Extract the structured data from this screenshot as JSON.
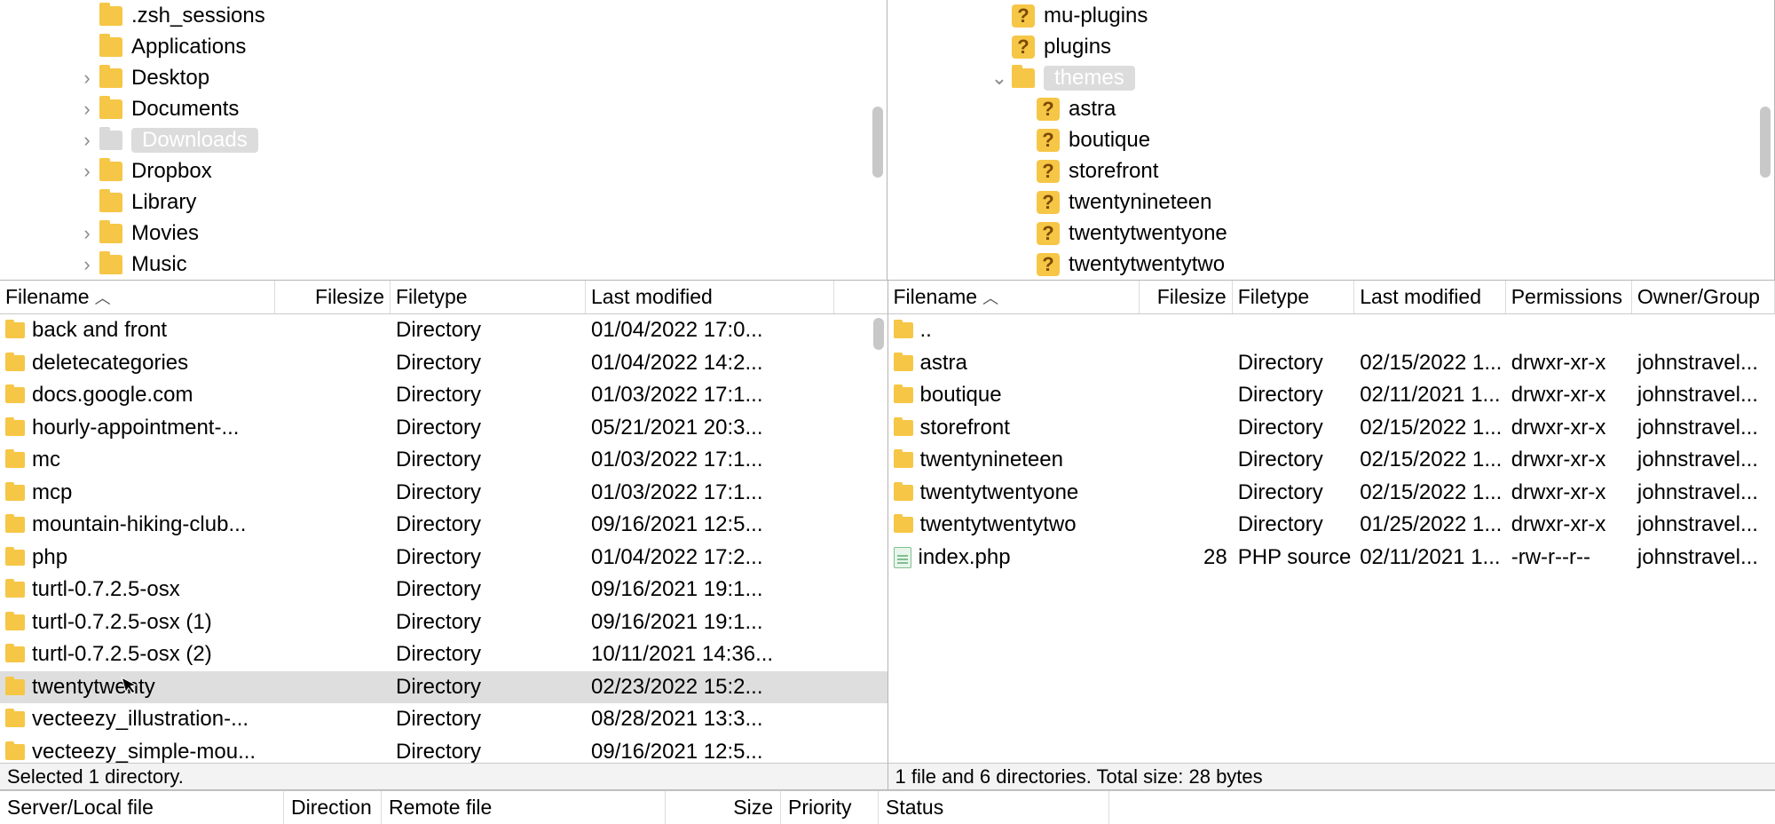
{
  "left_tree": [
    {
      "indent": 3,
      "chev": "",
      "icon": "folder",
      "label": ".zsh_sessions"
    },
    {
      "indent": 3,
      "chev": "",
      "icon": "folder",
      "label": "Applications"
    },
    {
      "indent": 3,
      "chev": ">",
      "icon": "folder",
      "label": "Desktop"
    },
    {
      "indent": 3,
      "chev": ">",
      "icon": "folder",
      "label": "Documents"
    },
    {
      "indent": 3,
      "chev": ">",
      "icon": "folder-sel",
      "label": "Downloads",
      "selected": true
    },
    {
      "indent": 3,
      "chev": ">",
      "icon": "folder",
      "label": "Dropbox"
    },
    {
      "indent": 3,
      "chev": "",
      "icon": "folder",
      "label": "Library"
    },
    {
      "indent": 3,
      "chev": ">",
      "icon": "folder",
      "label": "Movies"
    },
    {
      "indent": 3,
      "chev": ">",
      "icon": "folder",
      "label": "Music"
    }
  ],
  "right_tree": [
    {
      "indent": 4,
      "chev": "",
      "icon": "q",
      "label": "mu-plugins"
    },
    {
      "indent": 4,
      "chev": "",
      "icon": "q",
      "label": "plugins"
    },
    {
      "indent": 4,
      "chev": "v",
      "icon": "folder",
      "label": "themes",
      "selected": true
    },
    {
      "indent": 5,
      "chev": "",
      "icon": "q",
      "label": "astra"
    },
    {
      "indent": 5,
      "chev": "",
      "icon": "q",
      "label": "boutique"
    },
    {
      "indent": 5,
      "chev": "",
      "icon": "q",
      "label": "storefront"
    },
    {
      "indent": 5,
      "chev": "",
      "icon": "q",
      "label": "twentynineteen"
    },
    {
      "indent": 5,
      "chev": "",
      "icon": "q",
      "label": "twentytwentyone"
    },
    {
      "indent": 5,
      "chev": "",
      "icon": "q",
      "label": "twentytwentytwo",
      "cut": true
    }
  ],
  "left_cols": {
    "name": "Filename",
    "size": "Filesize",
    "type": "Filetype",
    "mod": "Last modified"
  },
  "right_cols": {
    "name": "Filename",
    "size": "Filesize",
    "type": "Filetype",
    "mod": "Last modified",
    "perm": "Permissions",
    "own": "Owner/Group"
  },
  "left_rows": [
    {
      "name": "back and front",
      "size": "",
      "type": "Directory",
      "mod": "01/04/2022 17:0..."
    },
    {
      "name": "deletecategories",
      "size": "",
      "type": "Directory",
      "mod": "01/04/2022 14:2..."
    },
    {
      "name": "docs.google.com",
      "size": "",
      "type": "Directory",
      "mod": "01/03/2022 17:1..."
    },
    {
      "name": "hourly-appointment-...",
      "size": "",
      "type": "Directory",
      "mod": "05/21/2021 20:3..."
    },
    {
      "name": "mc",
      "size": "",
      "type": "Directory",
      "mod": "01/03/2022 17:1..."
    },
    {
      "name": "mcp",
      "size": "",
      "type": "Directory",
      "mod": "01/03/2022 17:1..."
    },
    {
      "name": "mountain-hiking-club...",
      "size": "",
      "type": "Directory",
      "mod": "09/16/2021 12:5..."
    },
    {
      "name": "php",
      "size": "",
      "type": "Directory",
      "mod": "01/04/2022 17:2..."
    },
    {
      "name": "turtl-0.7.2.5-osx",
      "size": "",
      "type": "Directory",
      "mod": "09/16/2021 19:1..."
    },
    {
      "name": "turtl-0.7.2.5-osx (1)",
      "size": "",
      "type": "Directory",
      "mod": "09/16/2021 19:1..."
    },
    {
      "name": "turtl-0.7.2.5-osx (2)",
      "size": "",
      "type": "Directory",
      "mod": "10/11/2021 14:36..."
    },
    {
      "name": "twentytwenty",
      "size": "",
      "type": "Directory",
      "mod": "02/23/2022 15:2...",
      "selected": true
    },
    {
      "name": "vecteezy_illustration-...",
      "size": "",
      "type": "Directory",
      "mod": "08/28/2021 13:3..."
    },
    {
      "name": "vecteezy_simple-mou...",
      "size": "",
      "type": "Directory",
      "mod": "09/16/2021 12:5..."
    }
  ],
  "right_rows": [
    {
      "name": "..",
      "icon": "folder",
      "size": "",
      "type": "",
      "mod": "",
      "perm": "",
      "own": ""
    },
    {
      "name": "astra",
      "icon": "folder",
      "size": "",
      "type": "Directory",
      "mod": "02/15/2022 1...",
      "perm": "drwxr-xr-x",
      "own": "johnstravel..."
    },
    {
      "name": "boutique",
      "icon": "folder",
      "size": "",
      "type": "Directory",
      "mod": "02/11/2021 1...",
      "perm": "drwxr-xr-x",
      "own": "johnstravel..."
    },
    {
      "name": "storefront",
      "icon": "folder",
      "size": "",
      "type": "Directory",
      "mod": "02/15/2022 1...",
      "perm": "drwxr-xr-x",
      "own": "johnstravel..."
    },
    {
      "name": "twentynineteen",
      "icon": "folder",
      "size": "",
      "type": "Directory",
      "mod": "02/15/2022 1...",
      "perm": "drwxr-xr-x",
      "own": "johnstravel..."
    },
    {
      "name": "twentytwentyone",
      "icon": "folder",
      "size": "",
      "type": "Directory",
      "mod": "02/15/2022 1...",
      "perm": "drwxr-xr-x",
      "own": "johnstravel..."
    },
    {
      "name": "twentytwentytwo",
      "icon": "folder",
      "size": "",
      "type": "Directory",
      "mod": "01/25/2022 1...",
      "perm": "drwxr-xr-x",
      "own": "johnstravel..."
    },
    {
      "name": "index.php",
      "icon": "file",
      "size": "28",
      "type": "PHP source",
      "mod": "02/11/2021 1...",
      "perm": "-rw-r--r--",
      "own": "johnstravel..."
    }
  ],
  "left_status": "Selected 1 directory.",
  "right_status": "1 file and 6 directories. Total size: 28 bytes",
  "queue_cols": {
    "server": "Server/Local file",
    "dir": "Direction",
    "remote": "Remote file",
    "size": "Size",
    "prio": "Priority",
    "status": "Status"
  }
}
